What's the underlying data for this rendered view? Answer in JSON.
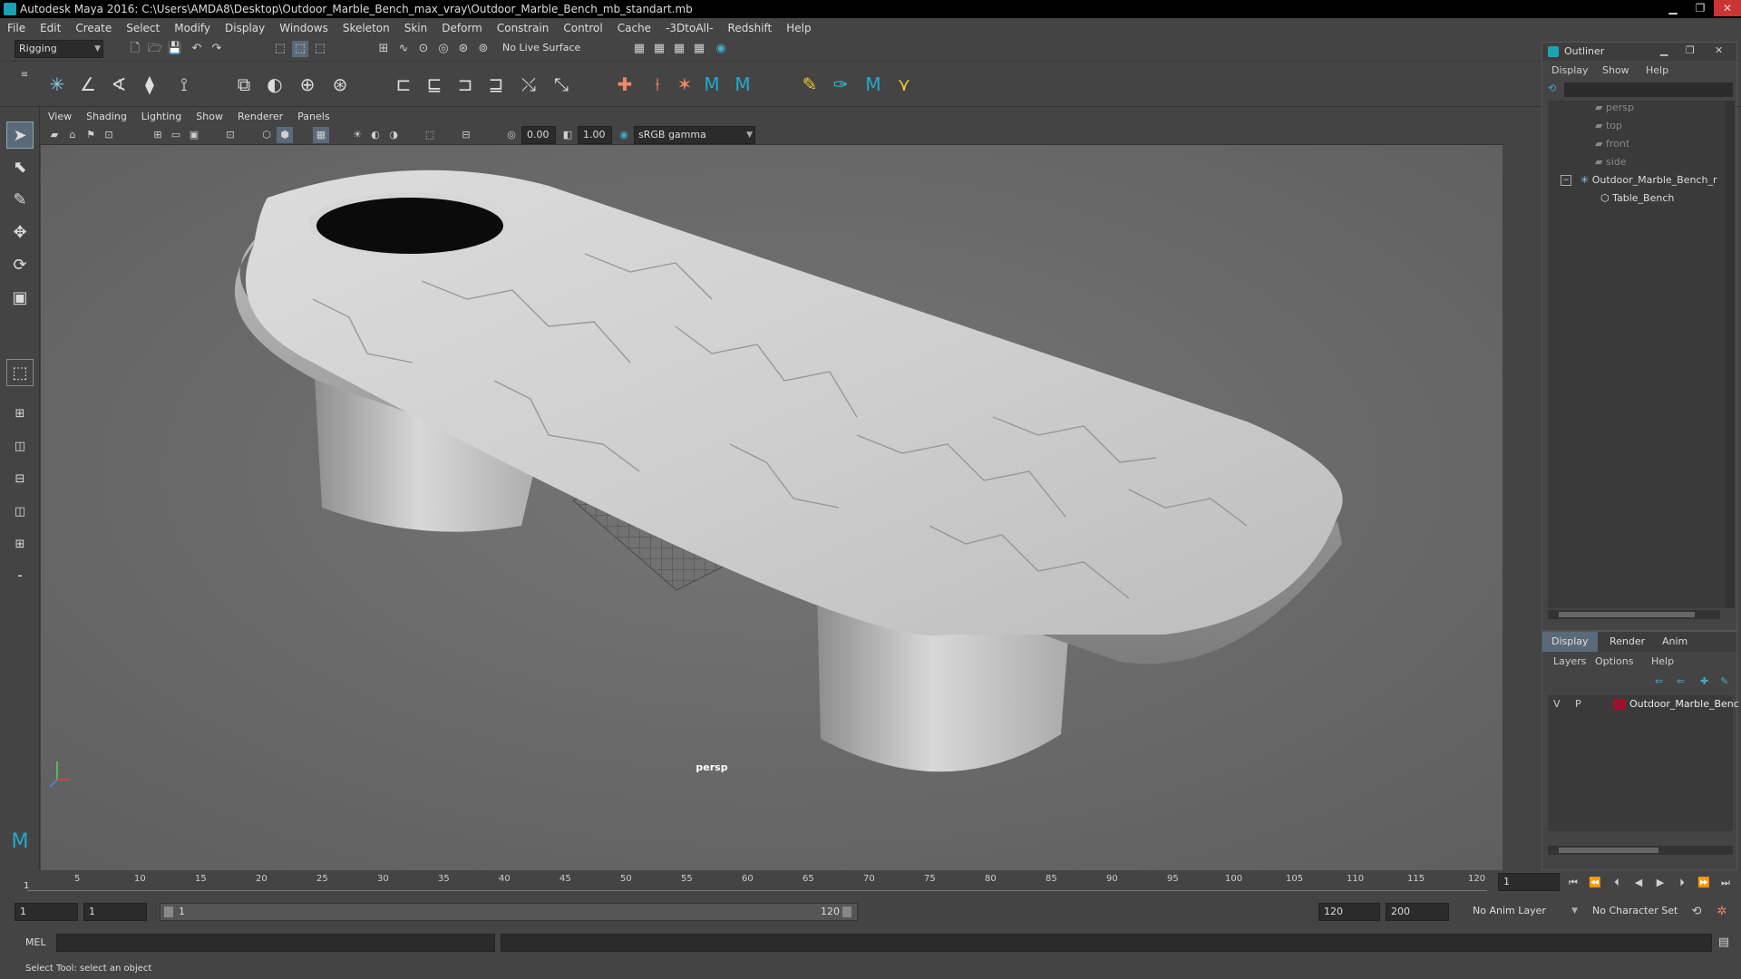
{
  "window": {
    "title": "Autodesk Maya 2016: C:\\Users\\AMDA8\\Desktop\\Outdoor_Marble_Bench_max_vray\\Outdoor_Marble_Bench_mb_standart.mb",
    "min": "▁",
    "max": "❐",
    "close": "✕"
  },
  "menus": [
    "File",
    "Edit",
    "Create",
    "Select",
    "Modify",
    "Display",
    "Windows",
    "Skeleton",
    "Skin",
    "Deform",
    "Constrain",
    "Control",
    "Cache",
    "-3DtoAll-",
    "Redshift",
    "Help"
  ],
  "status": {
    "mode": "Rigging",
    "live_surface": "No Live Surface"
  },
  "viewport": {
    "menus": [
      "View",
      "Shading",
      "Lighting",
      "Show",
      "Renderer",
      "Panels"
    ],
    "exposure": "0.00",
    "gamma": "1.00",
    "colorspace": "sRGB gamma",
    "camera_label": "persp"
  },
  "outliner": {
    "title": "Outliner",
    "menus": [
      "Display",
      "Show",
      "Help"
    ],
    "items": [
      {
        "label": "persp",
        "dim": true
      },
      {
        "label": "top",
        "dim": true
      },
      {
        "label": "front",
        "dim": true
      },
      {
        "label": "side",
        "dim": true
      },
      {
        "label": "Outdoor_Marble_Bench_r",
        "dim": false
      },
      {
        "label": "Table_Bench",
        "dim": false
      }
    ]
  },
  "channelbox": {
    "tabs": [
      "Display",
      "Render",
      "Anim"
    ],
    "menus": [
      "Layers",
      "Options",
      "Help"
    ],
    "layer": {
      "v": "V",
      "p": "P",
      "name": "Outdoor_Marble_Benc",
      "color": "#a0102a"
    }
  },
  "timeline": {
    "ticks": [
      "5",
      "10",
      "15",
      "20",
      "25",
      "30",
      "35",
      "40",
      "45",
      "50",
      "55",
      "60",
      "65",
      "70",
      "75",
      "80",
      "85",
      "90",
      "95",
      "100",
      "105",
      "110",
      "115",
      "120"
    ],
    "start_marker": "1",
    "current_frame": "1"
  },
  "range": {
    "start": "1",
    "anim_start": "1",
    "slider_start": "1",
    "slider_end": "120",
    "anim_end": "120",
    "end": "200",
    "anim_layer": "No Anim Layer",
    "char_set": "No Character Set"
  },
  "cmd": {
    "label": "MEL"
  },
  "help": {
    "text": "Select Tool: select an object"
  }
}
